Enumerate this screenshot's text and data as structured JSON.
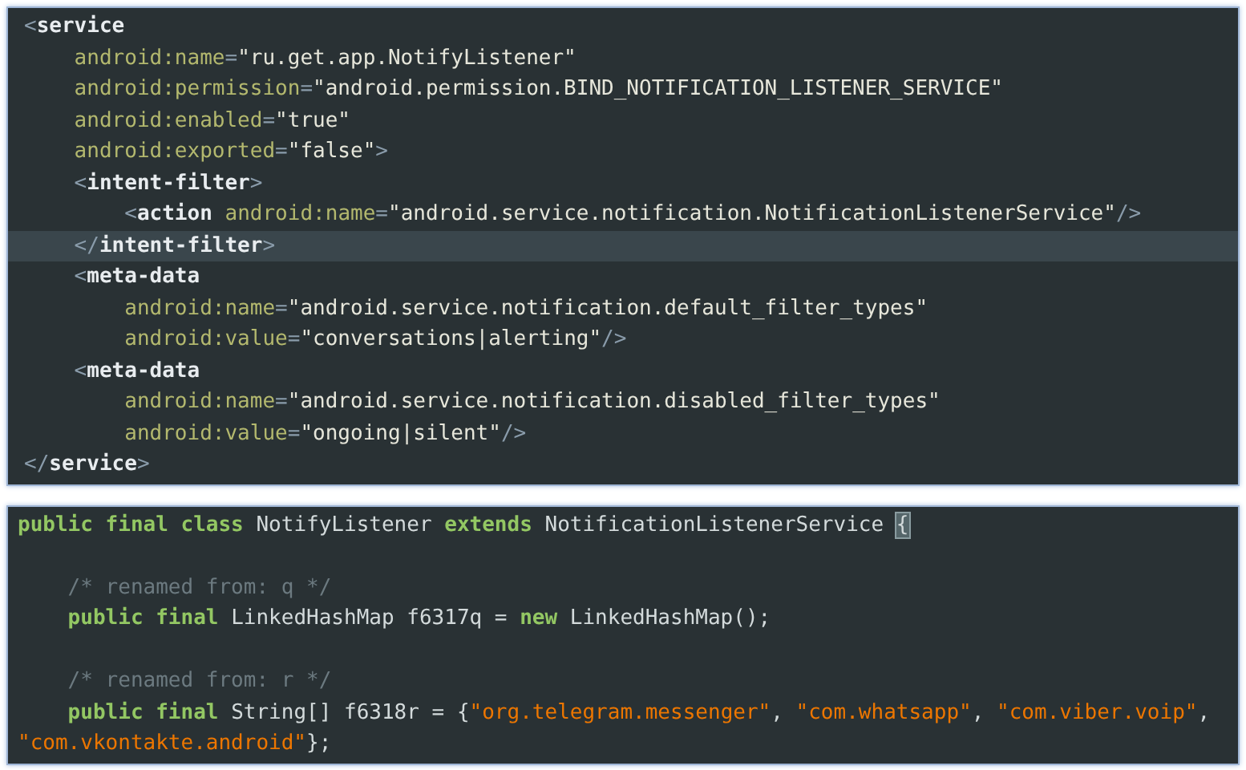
{
  "panels": [
    {
      "lines": [
        {
          "highlighted": false,
          "tokens": [
            {
              "kind": "punct",
              "text": "<"
            },
            {
              "kind": "tag",
              "text": "service"
            }
          ]
        },
        {
          "highlighted": false,
          "tokens": [
            {
              "kind": "attr",
              "text": "    android:name"
            },
            {
              "kind": "punct",
              "text": "="
            },
            {
              "kind": "value",
              "text": "\"ru.get.app.NotifyListener\""
            }
          ]
        },
        {
          "highlighted": false,
          "tokens": [
            {
              "kind": "attr",
              "text": "    android:permission"
            },
            {
              "kind": "punct",
              "text": "="
            },
            {
              "kind": "value",
              "text": "\"android.permission.BIND_NOTIFICATION_LISTENER_SERVICE\""
            }
          ]
        },
        {
          "highlighted": false,
          "tokens": [
            {
              "kind": "attr",
              "text": "    android:enabled"
            },
            {
              "kind": "punct",
              "text": "="
            },
            {
              "kind": "value",
              "text": "\"true\""
            }
          ]
        },
        {
          "highlighted": false,
          "tokens": [
            {
              "kind": "attr",
              "text": "    android:exported"
            },
            {
              "kind": "punct",
              "text": "="
            },
            {
              "kind": "value",
              "text": "\"false\""
            },
            {
              "kind": "punct",
              "text": ">"
            }
          ]
        },
        {
          "highlighted": false,
          "tokens": [
            {
              "kind": "punct",
              "text": "    <"
            },
            {
              "kind": "tag",
              "text": "intent-filter"
            },
            {
              "kind": "punct",
              "text": ">"
            }
          ]
        },
        {
          "highlighted": false,
          "tokens": [
            {
              "kind": "punct",
              "text": "        <"
            },
            {
              "kind": "tag",
              "text": "action "
            },
            {
              "kind": "attr",
              "text": "android:name"
            },
            {
              "kind": "punct",
              "text": "="
            },
            {
              "kind": "value",
              "text": "\"android.service.notification.NotificationListenerService\""
            },
            {
              "kind": "punct",
              "text": "/>"
            }
          ]
        },
        {
          "highlighted": true,
          "tokens": [
            {
              "kind": "punct",
              "text": "    </"
            },
            {
              "kind": "tag",
              "text": "intent-filter"
            },
            {
              "kind": "punct",
              "text": ">"
            }
          ]
        },
        {
          "highlighted": false,
          "tokens": [
            {
              "kind": "punct",
              "text": "    <"
            },
            {
              "kind": "tag",
              "text": "meta-data"
            }
          ]
        },
        {
          "highlighted": false,
          "tokens": [
            {
              "kind": "attr",
              "text": "        android:name"
            },
            {
              "kind": "punct",
              "text": "="
            },
            {
              "kind": "value",
              "text": "\"android.service.notification.default_filter_types\""
            }
          ]
        },
        {
          "highlighted": false,
          "tokens": [
            {
              "kind": "attr",
              "text": "        android:value"
            },
            {
              "kind": "punct",
              "text": "="
            },
            {
              "kind": "value",
              "text": "\"conversations|alerting\""
            },
            {
              "kind": "punct",
              "text": "/>"
            }
          ]
        },
        {
          "highlighted": false,
          "tokens": [
            {
              "kind": "punct",
              "text": "    <"
            },
            {
              "kind": "tag",
              "text": "meta-data"
            }
          ]
        },
        {
          "highlighted": false,
          "tokens": [
            {
              "kind": "attr",
              "text": "        android:name"
            },
            {
              "kind": "punct",
              "text": "="
            },
            {
              "kind": "value",
              "text": "\"android.service.notification.disabled_filter_types\""
            }
          ]
        },
        {
          "highlighted": false,
          "tokens": [
            {
              "kind": "attr",
              "text": "        android:value"
            },
            {
              "kind": "punct",
              "text": "="
            },
            {
              "kind": "value",
              "text": "\"ongoing|silent\""
            },
            {
              "kind": "punct",
              "text": "/>"
            }
          ]
        },
        {
          "highlighted": false,
          "tokens": [
            {
              "kind": "punct",
              "text": "</"
            },
            {
              "kind": "tag",
              "text": "service"
            },
            {
              "kind": "punct",
              "text": ">"
            }
          ]
        }
      ]
    },
    {
      "lines": [
        {
          "highlighted": false,
          "tokens": [
            {
              "kind": "keyword",
              "text": "public final class "
            },
            {
              "kind": "plain",
              "text": "NotifyListener "
            },
            {
              "kind": "keyword",
              "text": "extends "
            },
            {
              "kind": "plain",
              "text": "NotificationListenerService "
            },
            {
              "kind": "bracket-match",
              "text": "{"
            }
          ]
        },
        {
          "kind": "blank"
        },
        {
          "highlighted": false,
          "tokens": [
            {
              "kind": "comment",
              "text": "    /* renamed from: q */"
            }
          ]
        },
        {
          "highlighted": false,
          "tokens": [
            {
              "kind": "keyword",
              "text": "    public final "
            },
            {
              "kind": "plain",
              "text": "LinkedHashMap f6317q = "
            },
            {
              "kind": "keyword",
              "text": "new "
            },
            {
              "kind": "plain",
              "text": "LinkedHashMap();"
            }
          ]
        },
        {
          "kind": "blank"
        },
        {
          "highlighted": false,
          "tokens": [
            {
              "kind": "comment",
              "text": "    /* renamed from: r */"
            }
          ]
        },
        {
          "highlighted": false,
          "tokens": [
            {
              "kind": "keyword",
              "text": "    public final "
            },
            {
              "kind": "plain",
              "text": "String[] f6318r = {"
            },
            {
              "kind": "string",
              "text": "\"org.telegram.messenger\""
            },
            {
              "kind": "plain",
              "text": ", "
            },
            {
              "kind": "string",
              "text": "\"com.whatsapp\""
            },
            {
              "kind": "plain",
              "text": ", "
            },
            {
              "kind": "string",
              "text": "\"com.viber.voip\""
            },
            {
              "kind": "plain",
              "text": ","
            }
          ]
        },
        {
          "highlighted": false,
          "tokens": [
            {
              "kind": "string",
              "text": "\"com.vkontakte.android\""
            },
            {
              "kind": "plain",
              "text": "};"
            }
          ]
        }
      ]
    }
  ]
}
